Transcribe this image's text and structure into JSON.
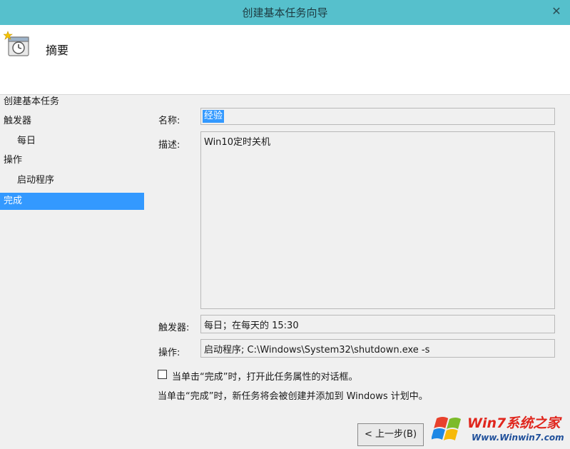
{
  "window": {
    "title": "创建基本任务向导",
    "close_glyph": "✕"
  },
  "header": {
    "title": "摘要",
    "icon": "scheduled-task-clock-icon"
  },
  "nav": {
    "items": [
      {
        "label": "创建基本任务",
        "selected": false
      },
      {
        "label": "触发器",
        "selected": false
      },
      {
        "label": "每日",
        "selected": false
      },
      {
        "label": "操作",
        "selected": false
      },
      {
        "label": "启动程序",
        "selected": false
      },
      {
        "label": "完成",
        "selected": true
      }
    ]
  },
  "form": {
    "name_label": "名称:",
    "name_value": "经验",
    "description_label": "描述:",
    "description_value": "Win10定时关机",
    "trigger_label": "触发器:",
    "trigger_value": "每日；在每天的 15:30",
    "action_label": "操作:",
    "action_value": "启动程序; C:\\Windows\\System32\\shutdown.exe -s",
    "open_properties_label": "当单击“完成”时，打开此任务属性的对话框。",
    "open_properties_checked": false,
    "finish_note": "当单击“完成”时，新任务将会被创建并添加到 Windows 计划中。"
  },
  "buttons": {
    "back_label": "< 上一步(B)"
  },
  "watermark": {
    "line1": "Win7系统之家",
    "line2": "Www.Winwin7.com"
  },
  "colors": {
    "titlebar": "#56c0cc",
    "selection": "#3399ff",
    "panel": "#f0f0f0"
  }
}
